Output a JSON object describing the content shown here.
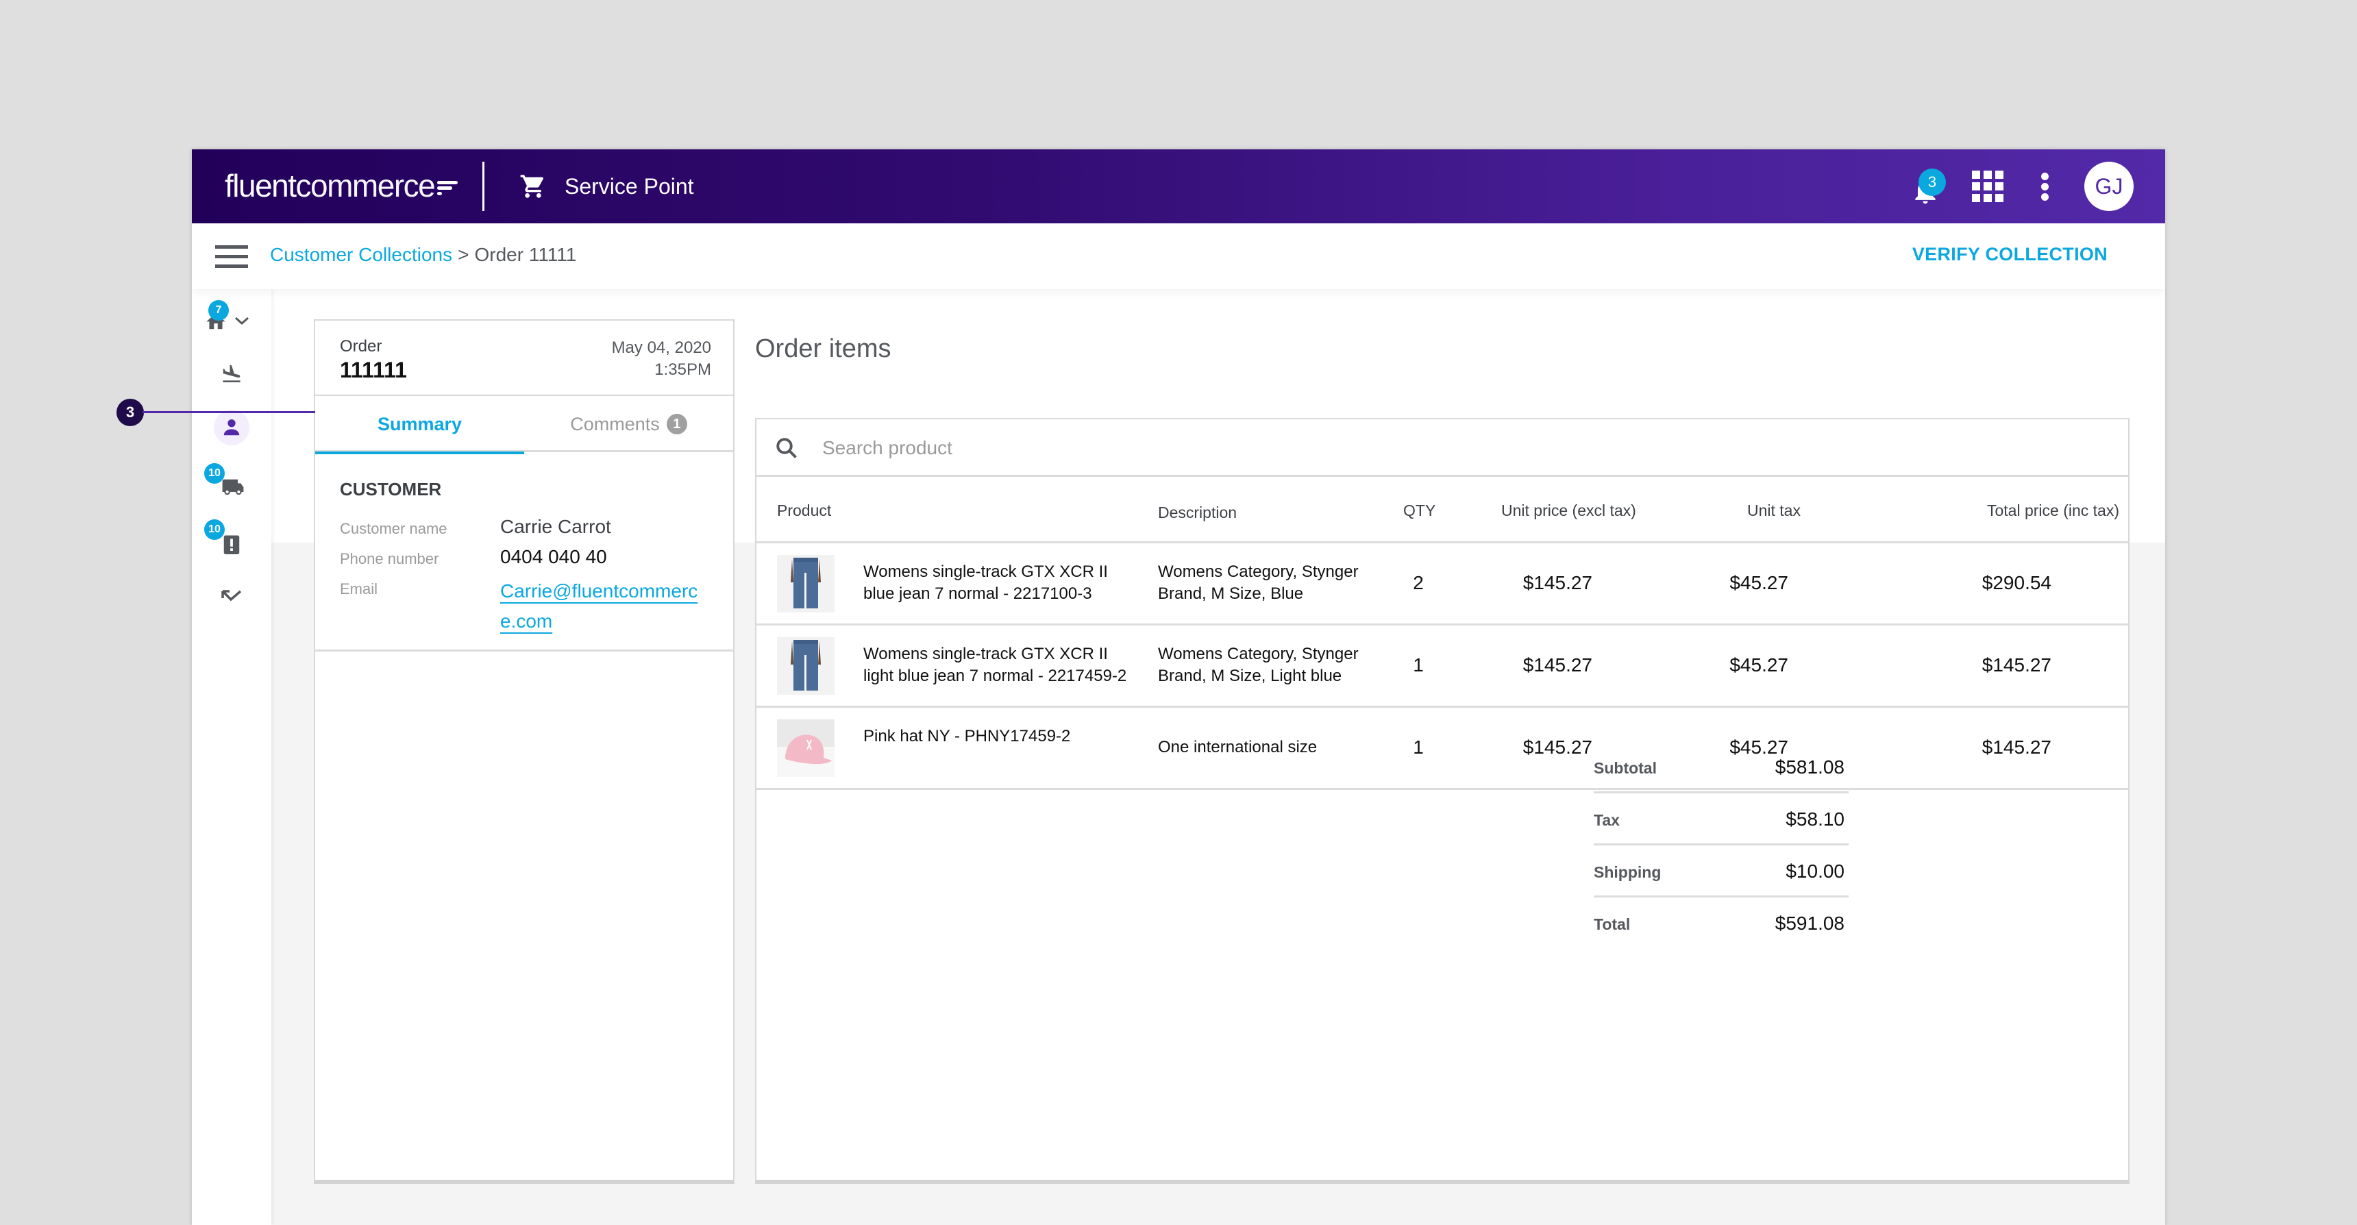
{
  "header": {
    "logo": {
      "bold": "fluent",
      "light": "commerce"
    },
    "app_name": "Service Point",
    "notifications_count": "3",
    "avatar_initials": "GJ",
    "brand_colors": {
      "gradient_start": "#22005a",
      "gradient_end": "#5229a8",
      "accent": "#0ba8e0"
    }
  },
  "subbar": {
    "breadcrumb": {
      "parent": "Customer Collections",
      "separator": ">",
      "current": "Order 11111"
    },
    "verify_button": "VERIFY COLLECTION"
  },
  "rail": {
    "items": [
      {
        "icon": "home-icon",
        "badge": "7"
      },
      {
        "icon": "arrivals-icon",
        "badge": null
      },
      {
        "icon": "person-icon",
        "badge": null,
        "active": true
      },
      {
        "icon": "truck-icon",
        "badge": "10"
      },
      {
        "icon": "clipboard-alert-icon",
        "badge": "10"
      },
      {
        "icon": "collapse-arrow-icon",
        "badge": null
      }
    ]
  },
  "annotation": {
    "callout_number": "3"
  },
  "order": {
    "label": "Order",
    "number": "111111",
    "date": "May 04, 2020",
    "time": "1:35PM"
  },
  "tabs": [
    {
      "label": "Summary",
      "active": true
    },
    {
      "label": "Comments",
      "count": "1",
      "active": false
    }
  ],
  "customer": {
    "title": "CUSTOMER",
    "fields": [
      {
        "label": "Customer name",
        "value": "Carrie Carrot"
      },
      {
        "label": "Phone number",
        "value": "0404 040 40"
      },
      {
        "label": "Email",
        "value": "Carrie@fluentcommerce.com"
      }
    ]
  },
  "order_items": {
    "title": "Order items",
    "search_placeholder": "Search product",
    "columns": [
      "Product",
      "Description",
      "QTY",
      "Unit price (excl tax)",
      "Unit tax",
      "Total price (inc tax)"
    ],
    "rows": [
      {
        "thumb": "jeans",
        "name": "Womens single-track GTX XCR II blue jean 7 normal - 2217100-3",
        "description": "Womens Category, Stynger Brand, M Size, Blue",
        "qty": "2",
        "unit_price": "$145.27",
        "unit_tax": "$45.27",
        "total": "$290.54"
      },
      {
        "thumb": "jeans",
        "name": "Womens single-track GTX XCR II light blue jean 7 normal - 2217459-2",
        "description": "Womens Category, Stynger Brand, M Size, Light blue",
        "qty": "1",
        "unit_price": "$145.27",
        "unit_tax": "$45.27",
        "total": "$145.27"
      },
      {
        "thumb": "pink-cap",
        "name": "Pink hat NY - PHNY17459-2",
        "description": "One international size",
        "qty": "1",
        "unit_price": "$145.27",
        "unit_tax": "$45.27",
        "total": "$145.27"
      }
    ],
    "totals": [
      {
        "label": "Subtotal",
        "value": "$581.08"
      },
      {
        "label": "Tax",
        "value": "$58.10"
      },
      {
        "label": "Shipping",
        "value": "$10.00"
      },
      {
        "label": "Total",
        "value": "$591.08"
      }
    ]
  }
}
